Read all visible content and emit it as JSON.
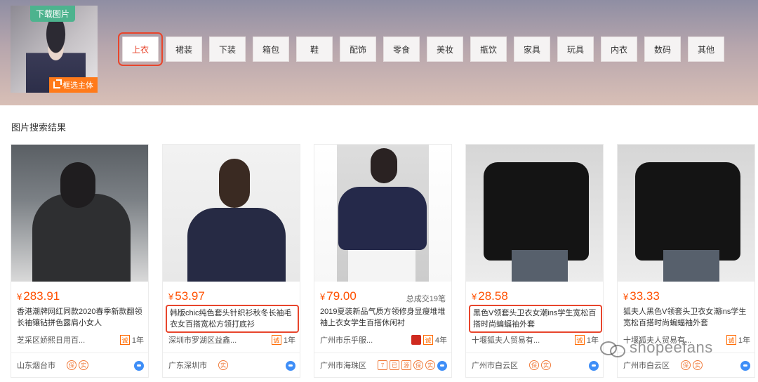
{
  "header": {
    "download_label": "下载图片",
    "crop_label": "框选主体",
    "categories": [
      {
        "label": "上衣",
        "active": true
      },
      {
        "label": "裙装"
      },
      {
        "label": "下装"
      },
      {
        "label": "箱包"
      },
      {
        "label": "鞋"
      },
      {
        "label": "配饰"
      },
      {
        "label": "零食"
      },
      {
        "label": "美妆"
      },
      {
        "label": "瓶饮"
      },
      {
        "label": "家具"
      },
      {
        "label": "玩具"
      },
      {
        "label": "内衣"
      },
      {
        "label": "数码"
      },
      {
        "label": "其他"
      }
    ]
  },
  "results": {
    "section_title": "图片搜索结果",
    "currency": "¥",
    "items": [
      {
        "price": "283.91",
        "sold": "",
        "title": "香港潮牌网红同款2020春季新款翻领长袖镶钻拼色露肩小女人",
        "shop": "芝采区娇熙日用百...",
        "years": "1年",
        "location": "山东烟台市",
        "badges": [
          "保",
          "实"
        ]
      },
      {
        "price": "53.97",
        "sold": "",
        "title": "韩版chic纯色套头针织衫秋冬长袖毛衣女百搭宽松方领打底衫",
        "shop": "深圳市罗湖区益鑫...",
        "years": "1年",
        "location": "广东深圳市",
        "badges": [
          "实"
        ]
      },
      {
        "price": "79.00",
        "sold": "总成交19笔",
        "title": "2019夏装新品气质方领修身显瘦堆堆袖上衣女学生百搭休闲衬",
        "shop": "广州市乐乎服...",
        "years": "4年",
        "location": "广州市海珠区",
        "badges": [
          "7",
          "已",
          "源",
          "保",
          "实"
        ]
      },
      {
        "price": "28.58",
        "sold": "",
        "title": "黑色V领套头卫衣女潮ins学生宽松百搭时尚蝙蝠袖外套",
        "shop": "十堰狐夫人贸易有...",
        "years": "1年",
        "location": "广州市白云区",
        "badges": [
          "保",
          "实"
        ]
      },
      {
        "price": "33.33",
        "sold": "",
        "title": "狐夫人黑色V领套头卫衣女潮ins学生宽松百搭时尚蝙蝠袖外套",
        "shop": "十堰狐夫人贸易有...",
        "years": "1年",
        "location": "广州市白云区",
        "badges": [
          "保",
          "实"
        ]
      }
    ]
  },
  "watermark": {
    "text": "shopeefans"
  },
  "colors": {
    "accent": "#e8452c",
    "price": "#ff5000",
    "badge_orange": "#ff7a1a",
    "download_green": "#4db38e"
  }
}
